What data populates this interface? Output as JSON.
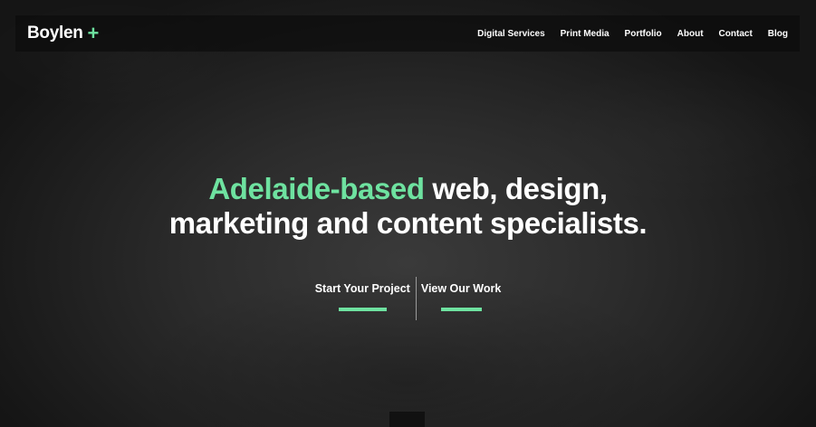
{
  "brand": {
    "name": "Boylen",
    "plus": "+"
  },
  "nav": {
    "items": [
      {
        "label": "Digital Services"
      },
      {
        "label": "Print Media"
      },
      {
        "label": "Portfolio"
      },
      {
        "label": "About"
      },
      {
        "label": "Contact"
      },
      {
        "label": "Blog"
      }
    ]
  },
  "hero": {
    "headline_accent": "Adelaide-based",
    "headline_line1_rest": " web, design,",
    "headline_line2": "marketing and content specialists."
  },
  "cta": {
    "start_label": "Start Your Project",
    "work_label": "View Our Work"
  },
  "colors": {
    "accent": "#6ee2a0",
    "background": "#2c2c2c",
    "nav_bg": "#0c0c0c",
    "text": "#ffffff"
  }
}
